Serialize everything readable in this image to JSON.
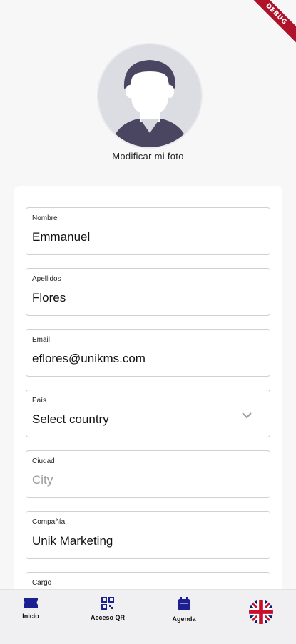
{
  "debug_banner": "DEBUG",
  "profile": {
    "change_photo_label": "Modificar mi foto"
  },
  "form": {
    "fields": [
      {
        "label": "Nombre",
        "value": "Emmanuel"
      },
      {
        "label": "Apellidos",
        "value": "Flores"
      },
      {
        "label": "Email",
        "value": "eflores@unikms.com"
      },
      {
        "label": "País",
        "value": "Select country"
      },
      {
        "label": "Ciudad",
        "placeholder": "City"
      },
      {
        "label": "Compañía",
        "value": "Unik Marketing"
      },
      {
        "label": "Cargo"
      }
    ]
  },
  "bottom_nav": {
    "items": [
      {
        "label": "Inicio",
        "icon": "ticket-icon"
      },
      {
        "label": "Acceso QR",
        "icon": "qr-code-icon"
      },
      {
        "label": "Agenda",
        "icon": "calendar-icon"
      }
    ],
    "language_icon": "uk-flag-icon"
  },
  "colors": {
    "accent": "#1c1f8f",
    "debug": "#b0122a"
  }
}
